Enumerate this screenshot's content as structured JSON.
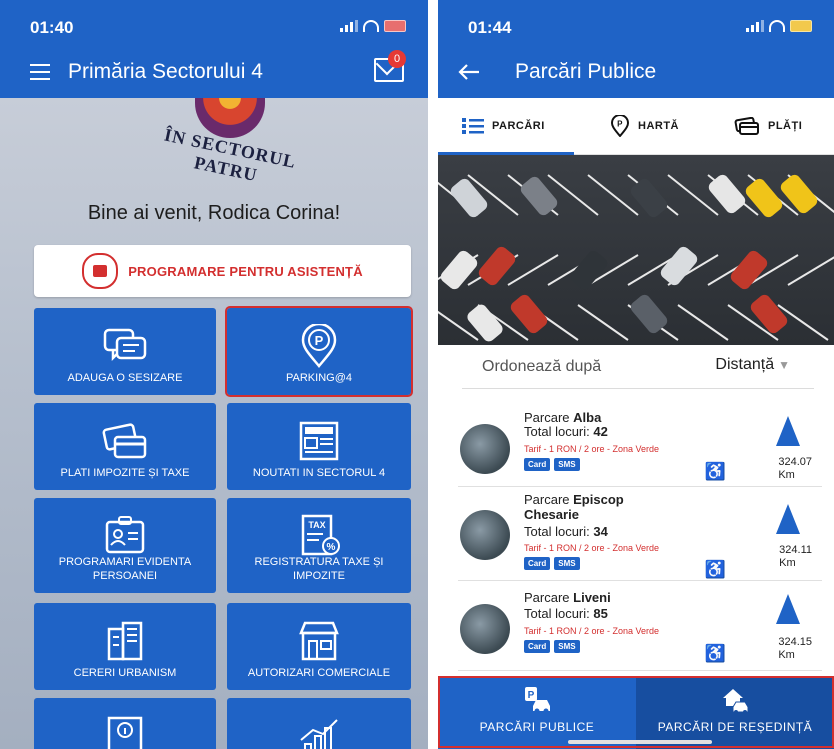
{
  "left": {
    "status": {
      "time": "01:40"
    },
    "header": {
      "title": "Primăria Sectorului 4",
      "mail_badge": "0"
    },
    "logo": {
      "text": "ÎN SECTORUL PATRU"
    },
    "welcome": "Bine ai venit, Rodica Corina!",
    "programare": {
      "label": "PROGRAMARE PENTRU ASISTENȚĂ"
    },
    "tiles": [
      {
        "label": "ADAUGA O SESIZARE",
        "icon": "chat-bubbles-icon"
      },
      {
        "label": "PARKING@4",
        "icon": "parking-pin-icon"
      },
      {
        "label": "PLATI IMPOZITE ȘI TAXE",
        "icon": "credit-cards-icon"
      },
      {
        "label": "NOUTATI IN SECTORUL 4",
        "icon": "newspaper-icon"
      },
      {
        "label": "PROGRAMARI EVIDENTA PERSOANEI",
        "icon": "id-card-icon"
      },
      {
        "label": "REGISTRATURA TAXE ȘI IMPOZITE",
        "icon": "tax-document-icon"
      },
      {
        "label": "CERERI URBANISM",
        "icon": "buildings-icon"
      },
      {
        "label": "AUTORIZARI COMERCIALE",
        "icon": "storefront-icon"
      },
      {
        "label": "",
        "icon": "info-book-icon"
      },
      {
        "label": "",
        "icon": "growth-chart-icon"
      }
    ],
    "highlighted_tile": "PARKING@4"
  },
  "right": {
    "status": {
      "time": "01:44"
    },
    "header": {
      "title": "Parcări Publice"
    },
    "tabs": [
      {
        "label": "PARCĂRI",
        "icon": "list-icon",
        "active": true
      },
      {
        "label": "HARTĂ",
        "icon": "map-pin-icon",
        "active": false
      },
      {
        "label": "PLĂȚI",
        "icon": "payment-card-icon",
        "active": false
      }
    ],
    "sort": {
      "label": "Ordonează după",
      "value": "Distanță"
    },
    "parkings": [
      {
        "prefix": "Parcare ",
        "name": "Alba",
        "total_label": "Total locuri: ",
        "total": "42",
        "tarif": "Tarif - 1 RON / 2 ore - Zona Verde",
        "chips": [
          "Card",
          "SMS"
        ],
        "distance": "324.07",
        "unit": "Km"
      },
      {
        "prefix": "Parcare ",
        "name": "Episcop Chesarie",
        "total_label": "Total locuri: ",
        "total": "34",
        "tarif": "Tarif - 1 RON / 2 ore - Zona Verde",
        "chips": [
          "Card",
          "SMS"
        ],
        "distance": "324.11",
        "unit": "Km"
      },
      {
        "prefix": "Parcare ",
        "name": "Liveni",
        "total_label": "Total locuri: ",
        "total": "85",
        "tarif": "Tarif - 1 RON / 2 ore - Zona Verde",
        "chips": [
          "Card",
          "SMS"
        ],
        "distance": "324.15",
        "unit": "Km"
      }
    ],
    "bottom_nav": [
      {
        "label": "PARCĂRI PUBLICE",
        "icon": "parking-car-icon",
        "active": true
      },
      {
        "label": "PARCĂRI DE REȘEDINȚĂ",
        "icon": "house-car-icon",
        "active": false
      }
    ],
    "colors": {
      "primary": "#1f63c6",
      "primary_dark": "#174ea0",
      "alert": "#d32f2f"
    }
  }
}
